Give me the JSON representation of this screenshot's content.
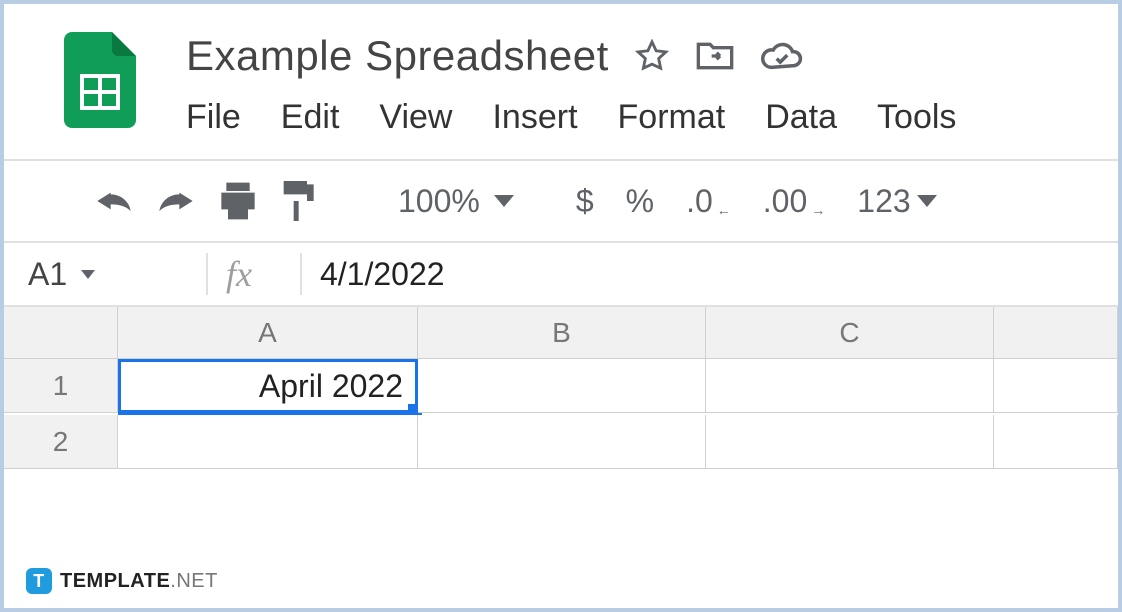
{
  "header": {
    "title": "Example Spreadsheet"
  },
  "menu": {
    "file": "File",
    "edit": "Edit",
    "view": "View",
    "insert": "Insert",
    "format": "Format",
    "data": "Data",
    "tools": "Tools"
  },
  "toolbar": {
    "zoom": "100%",
    "currency": "$",
    "percent": "%",
    "dec_less": ".0",
    "dec_more": ".00",
    "num_format": "123"
  },
  "formula_bar": {
    "cell_ref": "A1",
    "fx_label": "fx",
    "formula": "4/1/2022"
  },
  "columns": {
    "a": "A",
    "b": "B",
    "c": "C"
  },
  "rows": {
    "r1": "1",
    "r2": "2"
  },
  "cells": {
    "a1": "April 2022"
  },
  "watermark": {
    "badge": "T",
    "name": "TEMPLATE",
    "suffix": ".NET"
  }
}
